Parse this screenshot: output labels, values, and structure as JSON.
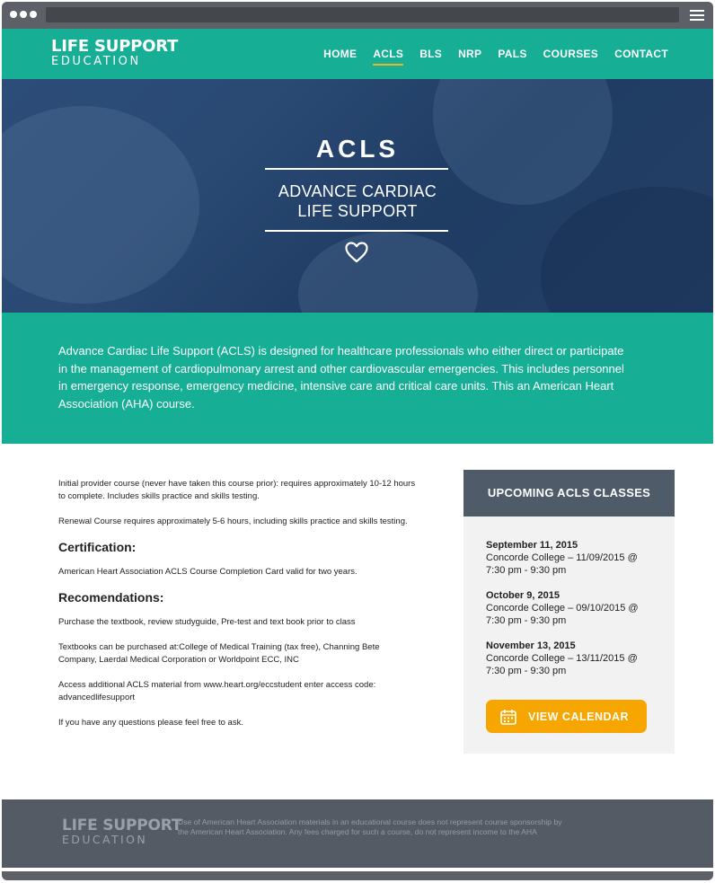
{
  "header": {
    "logo_top": "LIFE SUPPORT",
    "logo_bottom": "EDUCATION",
    "nav": [
      {
        "label": "HOME"
      },
      {
        "label": "ACLS"
      },
      {
        "label": "BLS"
      },
      {
        "label": "NRP"
      },
      {
        "label": "PALS"
      },
      {
        "label": "COURSES"
      },
      {
        "label": "CONTACT"
      }
    ],
    "active_nav": "ACLS"
  },
  "hero": {
    "title": "ACLS",
    "subtitle_line1": "ADVANCE CARDIAC",
    "subtitle_line2": "LIFE SUPPORT",
    "icon": "heart-icon"
  },
  "intro": {
    "text": "Advance Cardiac Life Support (ACLS) is designed for healthcare professionals who either direct or participate in the management of cardiopulmonary arrest and other cardiovascular emergencies. This includes personnel in emergency response, emergency medicine, intensive care and critical care units. This an American Heart Association (AHA) course."
  },
  "main": {
    "p1": "Initial provider course (never have taken this course prior): requires approximately 10-12 hours to complete. Includes skills practice and skills testing.",
    "p2": "Renewal Course requires approximately 5-6 hours, including skills practice and skills testing.",
    "certification_heading": "Certification:",
    "certification_text": "American Heart Association ACLS Course Completion Card valid for two years.",
    "recommendations_heading": "Recomendations:",
    "rec1": "Purchase the textbook, review studyguide, Pre-test and text book prior to class",
    "rec2": "Textbooks can be purchased at:College of Medical Training (tax free), Channing Bete Company, Laerdal Medical Corporation or Worldpoint ECC, INC",
    "rec3": "Access additional ACLS material from www.heart.org/eccstudent enter access code: advancedlifesupport",
    "rec4": "If you have any questions please feel free to ask."
  },
  "sidebar": {
    "heading": "UPCOMING ACLS CLASSES",
    "events": [
      {
        "date": "September 11, 2015",
        "detail": "Concorde College – 11/09/2015 @ 7:30 pm - 9:30 pm"
      },
      {
        "date": "October 9, 2015",
        "detail": "Concorde College – 09/10/2015 @ 7:30 pm - 9:30 pm"
      },
      {
        "date": "November 13, 2015",
        "detail": "Concorde College – 13/11/2015 @ 7:30 pm - 9:30 pm"
      }
    ],
    "button_label": "VIEW CALENDAR",
    "button_icon": "calendar-icon"
  },
  "footer": {
    "logo_top": "LIFE SUPPORT",
    "logo_bottom": "EDUCATION",
    "disclaimer": "Use of American Heart Association materials in an educational course does not represent course sponsorship by the American Heart Association. Any fees charged for such a course, do not represent income to the AHA"
  },
  "colors": {
    "brand_teal": "#16ae95",
    "hero_blue": "#2a4a74",
    "accent_orange": "#f7a600",
    "sidebar_head": "#4f5b69",
    "footer_bg": "#545b65"
  }
}
